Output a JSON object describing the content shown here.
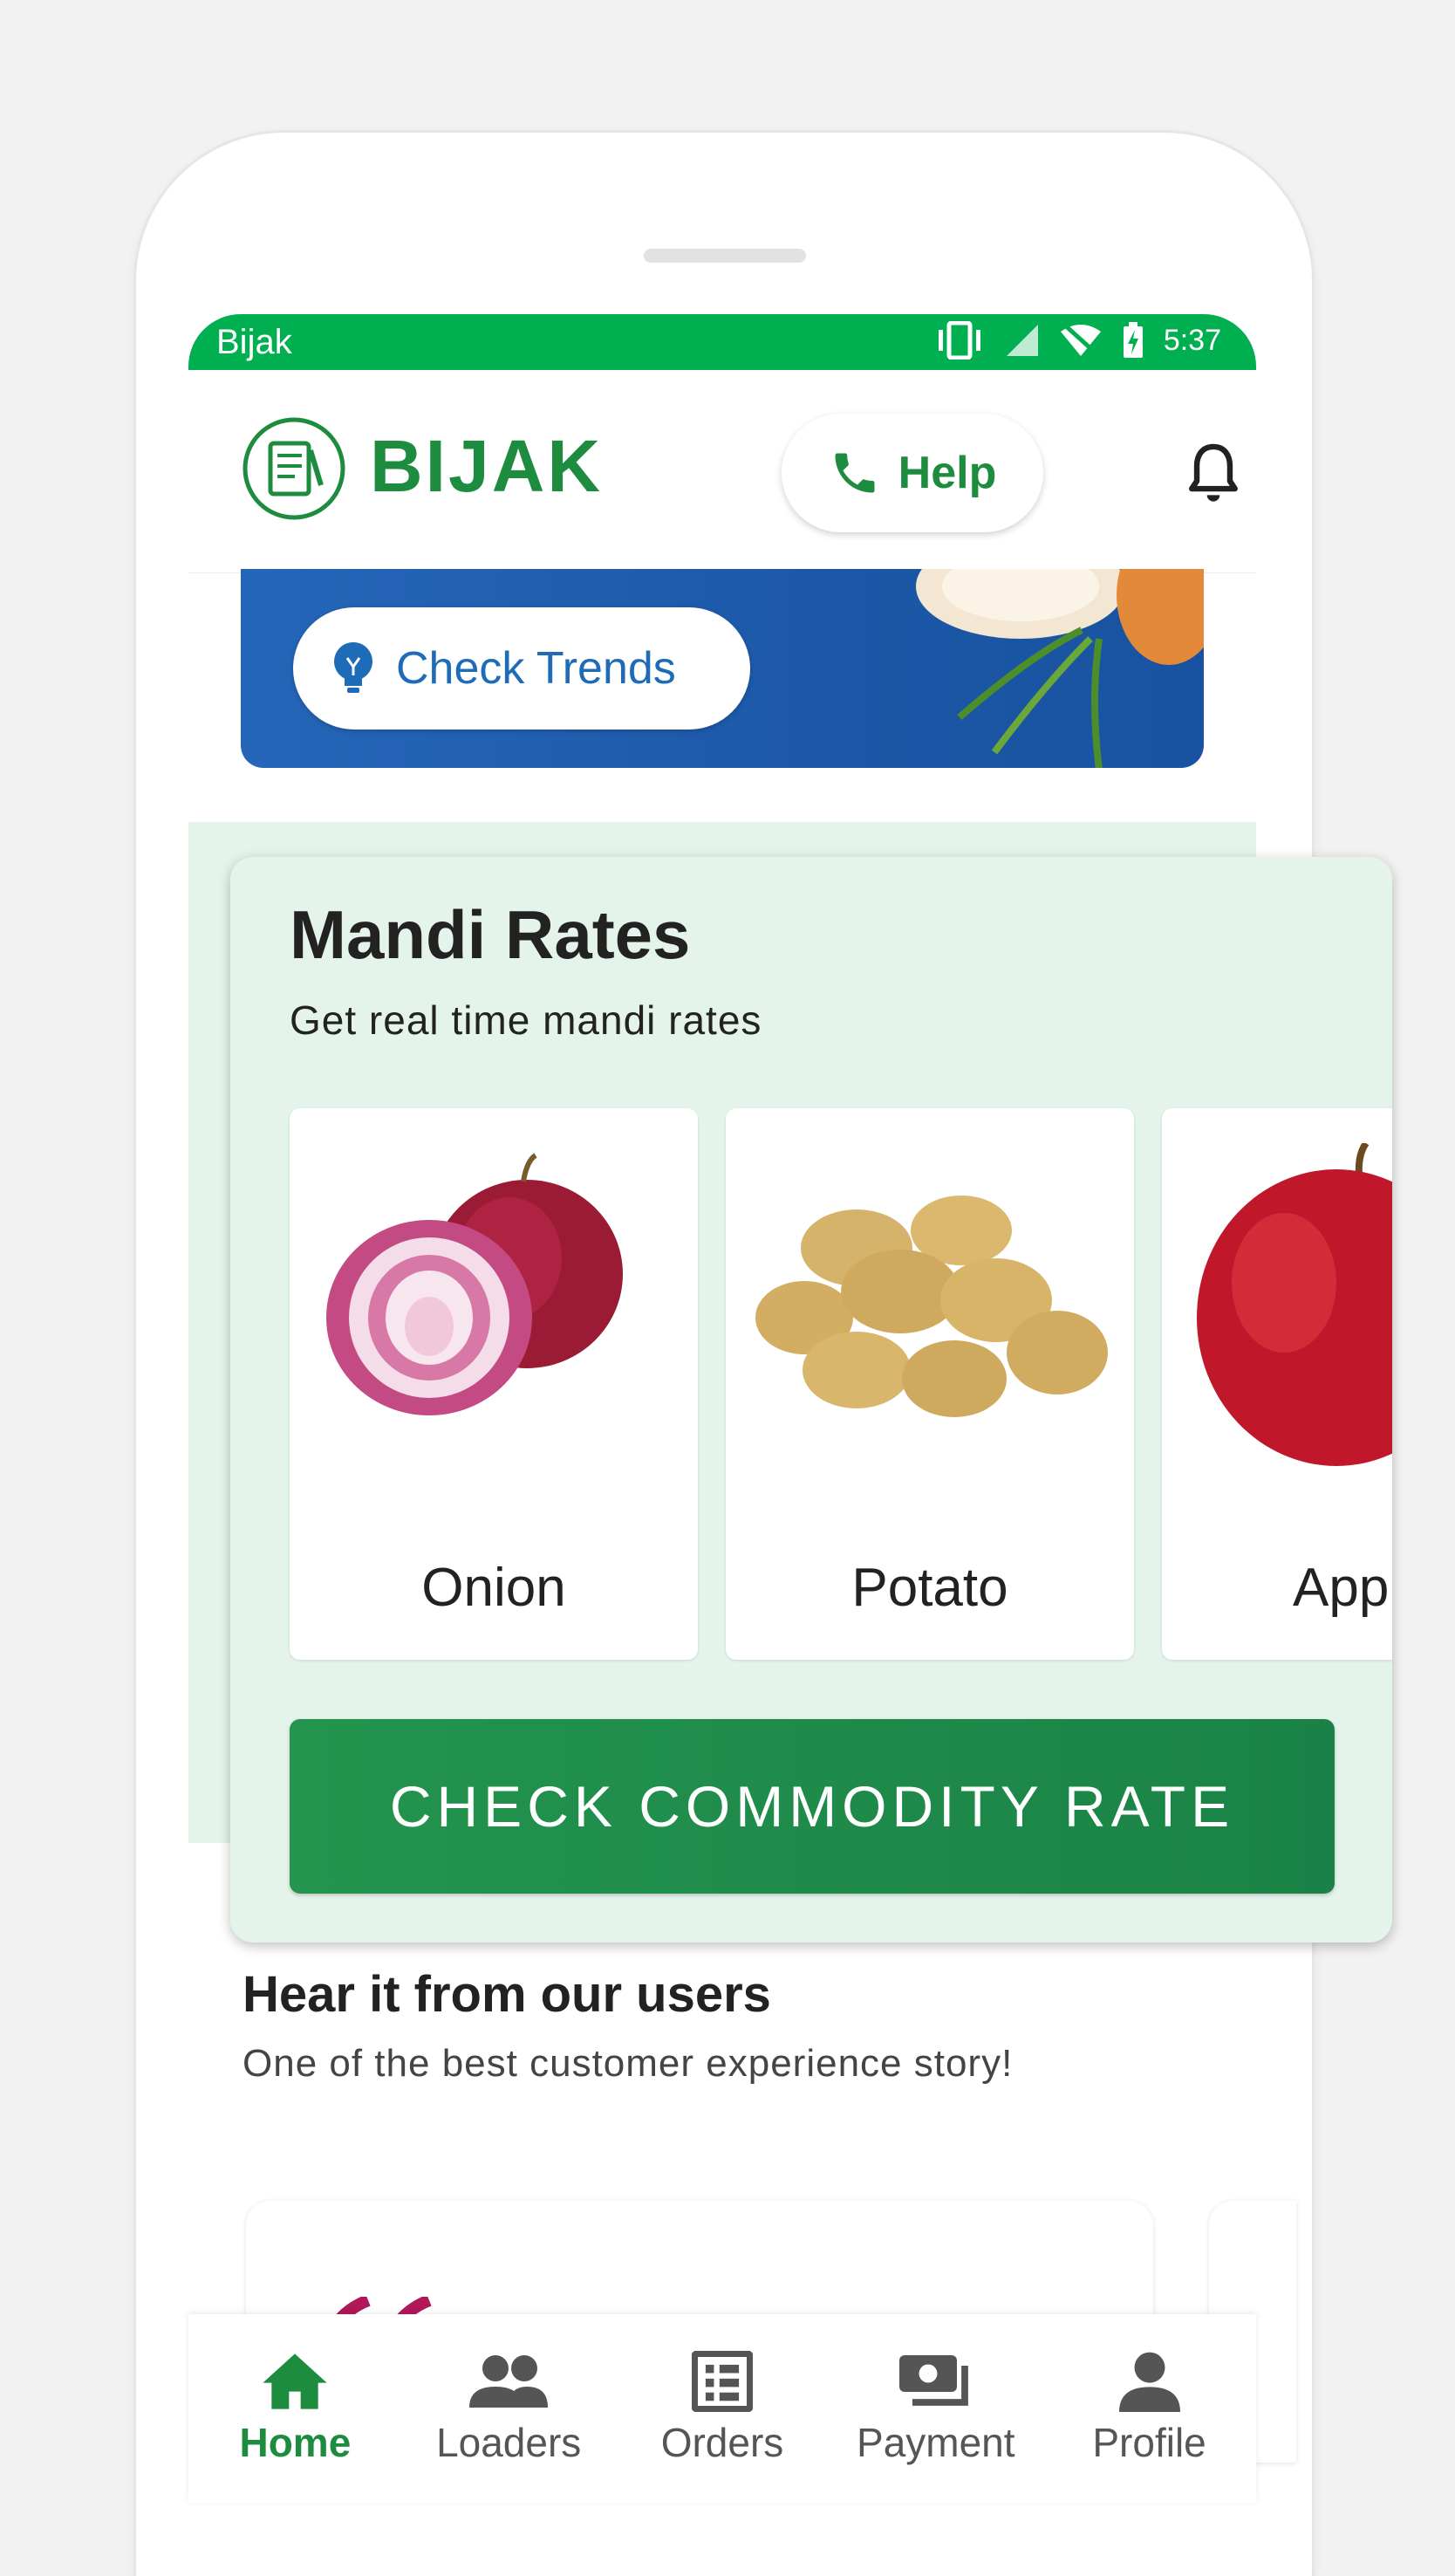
{
  "status_bar": {
    "app_name": "Bijak",
    "time": "5:37"
  },
  "header": {
    "logo_text": "BIJAK",
    "help_label": "Help"
  },
  "banner": {
    "button_label": "Check Trends"
  },
  "mandi": {
    "title": "Mandi Rates",
    "subtitle": "Get real time mandi rates",
    "commodities": [
      {
        "name": "Onion",
        "icon": "onion-image"
      },
      {
        "name": "Potato",
        "icon": "potato-image"
      },
      {
        "name": "App",
        "icon": "apple-image"
      }
    ],
    "cta_label": "CHECK COMMODITY RATE"
  },
  "users": {
    "title": "Hear it from our users",
    "subtitle": "One of the best customer experience story!"
  },
  "nav": {
    "items": [
      {
        "label": "Home",
        "icon": "home-icon",
        "active": true
      },
      {
        "label": "Loaders",
        "icon": "people-icon",
        "active": false
      },
      {
        "label": "Orders",
        "icon": "list-icon",
        "active": false
      },
      {
        "label": "Payment",
        "icon": "cash-icon",
        "active": false
      },
      {
        "label": "Profile",
        "icon": "person-icon",
        "active": false
      }
    ]
  },
  "colors": {
    "brand_green": "#1e8c3f",
    "status_green": "#00b050",
    "banner_blue": "#1d58a8",
    "mandi_bg": "#e4f4eb"
  }
}
